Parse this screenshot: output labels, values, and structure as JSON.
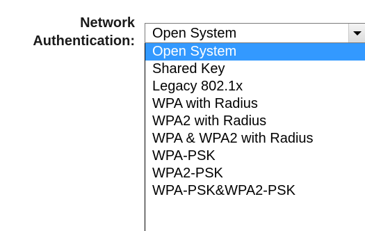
{
  "field": {
    "label_line1": "Network",
    "label_line2": "Authentication:"
  },
  "select": {
    "value": "Open System",
    "arrow_icon": "chevron-down-icon",
    "highlight_color": "#3399ff",
    "options": [
      "Open System",
      "Shared Key",
      "Legacy 802.1x",
      "WPA with Radius",
      "WPA2 with Radius",
      "WPA & WPA2 with Radius",
      "WPA-PSK",
      "WPA2-PSK",
      "WPA-PSK&WPA2-PSK"
    ],
    "highlighted_index": 0
  }
}
